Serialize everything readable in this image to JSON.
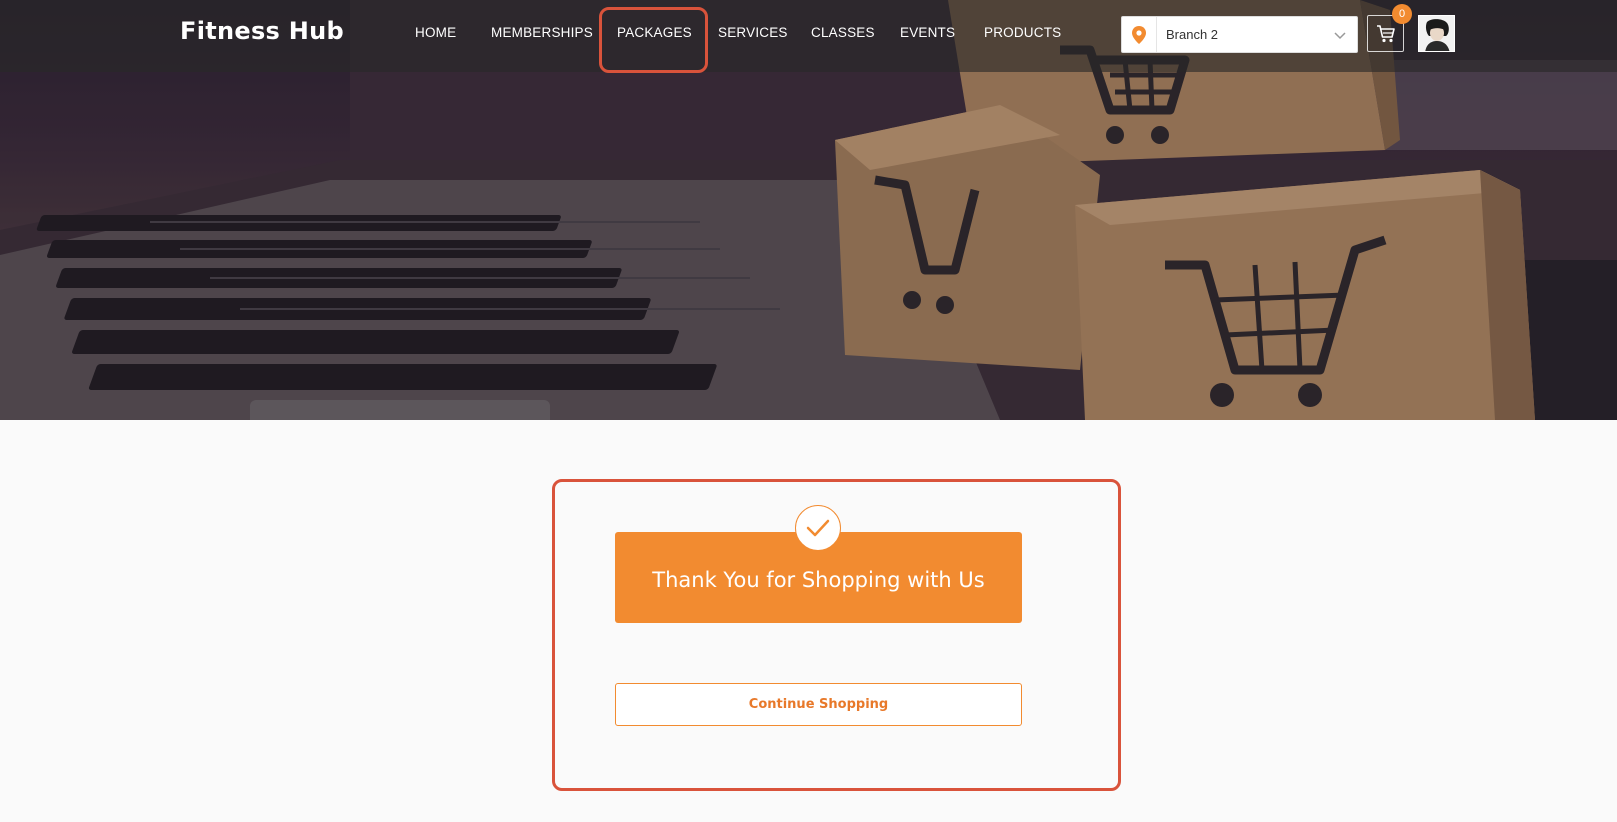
{
  "navbar": {
    "brand": "Fitness Hub",
    "items": [
      {
        "label": "HOME"
      },
      {
        "label": "MEMBERSHIPS"
      },
      {
        "label": "PACKAGES"
      },
      {
        "label": "SERVICES"
      },
      {
        "label": "CLASSES"
      },
      {
        "label": "EVENTS"
      },
      {
        "label": "PRODUCTS"
      }
    ],
    "branch_select": {
      "value": "Branch 2",
      "icon": "map-pin-icon"
    },
    "cart": {
      "count": "0",
      "icon": "shopping-cart-icon"
    },
    "avatar": {
      "icon": "user-avatar"
    }
  },
  "confirmation": {
    "title": "Thank You for Shopping with Us",
    "icon": "checkmark-icon",
    "continue_label": "Continue Shopping"
  },
  "colors": {
    "accent": "#f28b30",
    "highlight_outline": "#d9533b",
    "navbar_bg": "rgba(40,40,40,0.62)",
    "page_bg": "#fafafa"
  }
}
